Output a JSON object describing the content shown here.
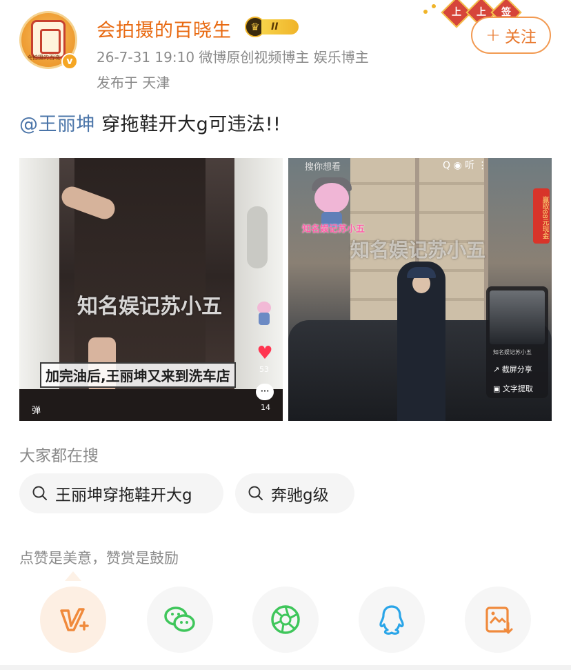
{
  "header": {
    "username": "会拍摄的百晓生",
    "vip_level": "II",
    "avatar_text": "会拍摄的百晓",
    "verified": "v",
    "meta": "26-7-31 19:10  微博原创视频博主 娱乐博主",
    "location": "发布于 天津",
    "follow_label": "关注",
    "festive_chars": [
      "上",
      "上",
      "签"
    ]
  },
  "post": {
    "mention": "@王丽坤",
    "text": " 穿拖鞋开大g可违法!!"
  },
  "images": [
    {
      "watermark": "知名娱记苏小五",
      "subtitle": "加完油后,王丽坤又来到洗车店",
      "like_count": "53",
      "comment_count": "14",
      "danmu": "弹"
    },
    {
      "search_placeholder": "搜你想看",
      "top_icons": "Q   ◉   听   ⋮",
      "chibi_label": "知名娱记苏小五",
      "watermark": "知名娱记苏小五",
      "promo": "赢取88元现金",
      "popup_items": [
        "截屏分享",
        "文字提取"
      ],
      "popup_thumb_label": "知名娱记苏小五"
    }
  ],
  "search_section": {
    "title": "大家都在搜",
    "chips": [
      "王丽坤穿拖鞋开大g",
      "奔驰g级"
    ]
  },
  "reward": {
    "title": "点赞是美意，赞赏是鼓励"
  },
  "share": {
    "buttons": [
      "reward-icon",
      "wechat-icon",
      "moments-icon",
      "qq-icon",
      "save-image-icon"
    ]
  },
  "colors": {
    "username": "#e86a12",
    "mention": "#4a74a8",
    "follow": "#e8762a",
    "wechat": "#3fc65b",
    "qq": "#2aa5e8",
    "reward": "#f08a3c"
  }
}
